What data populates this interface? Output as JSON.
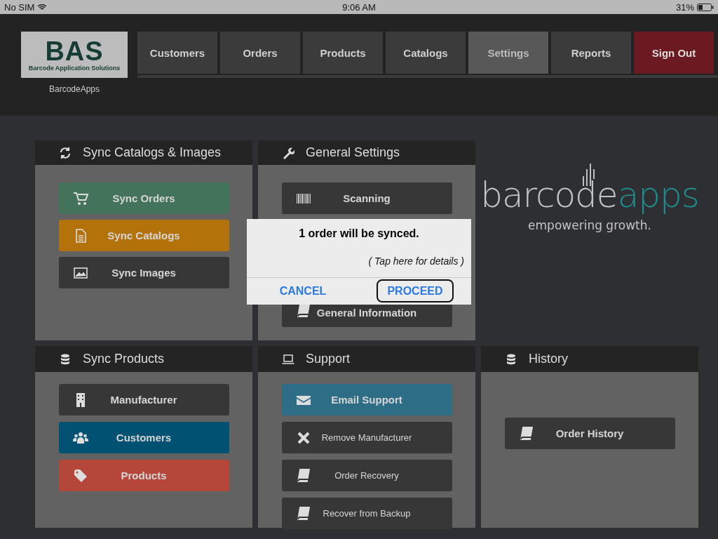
{
  "status_bar": {
    "carrier": "No SIM",
    "time": "9:06 AM",
    "battery": "31%"
  },
  "header": {
    "logo": {
      "mark": "BAS",
      "tagline": "Barcode Application Solutions",
      "caption": "BarcodeApps"
    },
    "tabs": [
      {
        "label": "Customers",
        "selected": false,
        "kind": "nav"
      },
      {
        "label": "Orders",
        "selected": false,
        "kind": "nav"
      },
      {
        "label": "Products",
        "selected": false,
        "kind": "nav"
      },
      {
        "label": "Catalogs",
        "selected": false,
        "kind": "nav"
      },
      {
        "label": "Settings",
        "selected": true,
        "kind": "nav"
      },
      {
        "label": "Reports",
        "selected": false,
        "kind": "nav"
      },
      {
        "label": "Sign Out",
        "selected": false,
        "kind": "signout"
      }
    ]
  },
  "panels": [
    {
      "title": "Sync Catalogs & Images",
      "buttons": [
        {
          "label": "Sync Orders",
          "color": "#43735a",
          "bold": true
        },
        {
          "label": "Sync Catalogs",
          "color": "#b3720a",
          "bold": true
        },
        {
          "label": "Sync Images",
          "color": "#373737",
          "bold": true
        }
      ]
    },
    {
      "title": "General Settings",
      "buttons": [
        {
          "label": "Scanning",
          "color": "#373737",
          "bold": true
        },
        {
          "label": "General Information",
          "color": "#373737",
          "bold": true
        }
      ]
    },
    {
      "title": "Sync Products",
      "buttons": [
        {
          "label": "Manufacturer",
          "color": "#373737",
          "bold": true
        },
        {
          "label": "Customers",
          "color": "#005172",
          "bold": true
        },
        {
          "label": "Products",
          "color": "#b5473a",
          "bold": true
        }
      ]
    },
    {
      "title": "Support",
      "buttons": [
        {
          "label": "Email Support",
          "color": "#2e6d86",
          "bold": true
        },
        {
          "label": "Remove Manufacturer",
          "color": "#373737",
          "bold": false
        },
        {
          "label": "Order Recovery",
          "color": "#373737",
          "bold": false
        },
        {
          "label": "Recover from Backup",
          "color": "#373737",
          "bold": false
        }
      ]
    },
    {
      "title": "History",
      "buttons": [
        {
          "label": "Order History",
          "color": "#373737",
          "bold": true
        }
      ]
    }
  ],
  "brand": {
    "main": "barcode",
    "accent": "apps",
    "slogan": "empowering growth."
  },
  "dialog": {
    "message": "1 order will be synced.",
    "details": "( Tap here for details )",
    "buttons": [
      {
        "label": "CANCEL",
        "selected": false
      },
      {
        "label": "PROCEED",
        "selected": true
      }
    ]
  }
}
